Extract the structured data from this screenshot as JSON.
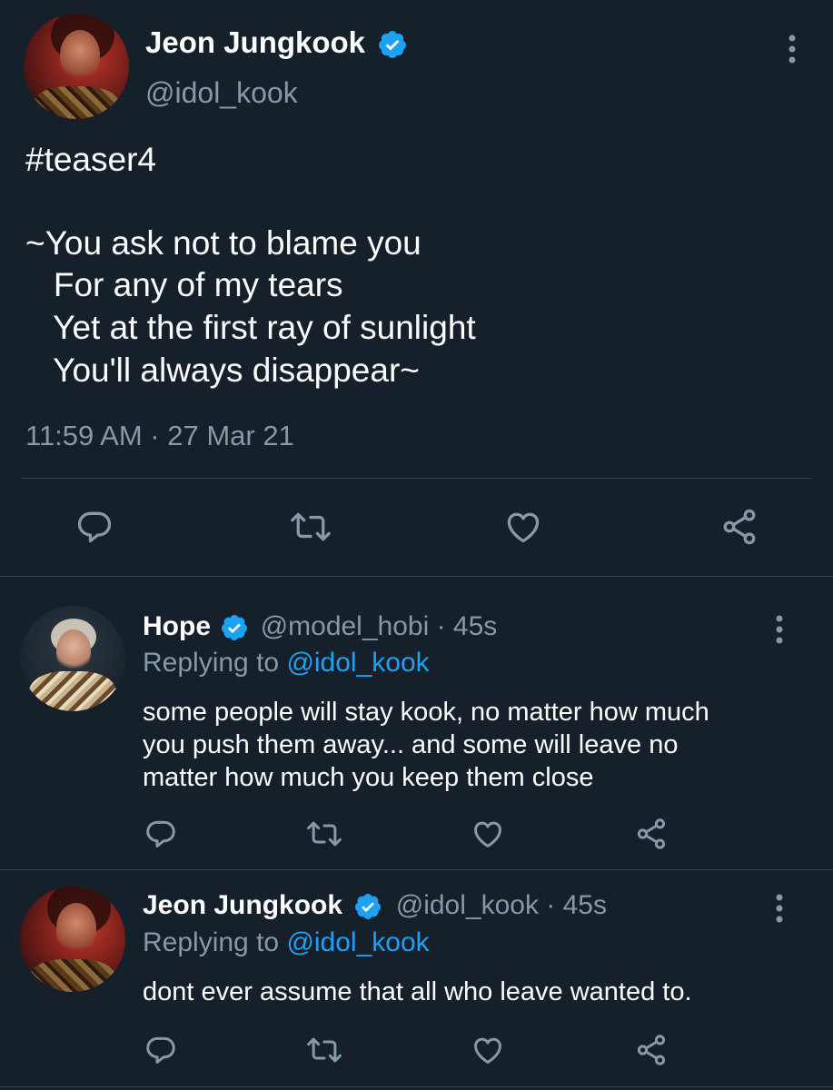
{
  "main_tweet": {
    "author_name": "Jeon Jungkook",
    "author_handle": "@idol_kook",
    "hashtag": "#teaser4",
    "body_lines": [
      "~You ask not to blame you",
      "   For any of my tears",
      "   Yet at the first ray of sunlight",
      "   You'll always disappear~"
    ],
    "timestamp": "11:59 AM · 27 Mar 21"
  },
  "replies": [
    {
      "author_name": "Hope",
      "handle_time": "@model_hobi · 45s",
      "replying_prefix": "Replying to ",
      "replying_to": "@idol_kook",
      "text_lines": [
        "some people will stay kook, no matter how much",
        "you push them away... and some will leave no",
        "matter how much you keep them close"
      ]
    },
    {
      "author_name": "Jeon Jungkook",
      "handle_time": "@idol_kook · 45s",
      "replying_prefix": "Replying to ",
      "replying_to": "@idol_kook",
      "text_lines": [
        "dont ever assume that all who leave wanted to."
      ]
    }
  ],
  "icons": {
    "reply": "reply-icon",
    "retweet": "retweet-icon",
    "like": "heart-icon",
    "share": "share-icon",
    "more": "more-vertical-icon",
    "verified": "verified-badge-icon"
  },
  "colors": {
    "background": "#15202b",
    "accent": "#1da1f2",
    "secondary_text": "#8899a6",
    "divider": "#38444d"
  }
}
